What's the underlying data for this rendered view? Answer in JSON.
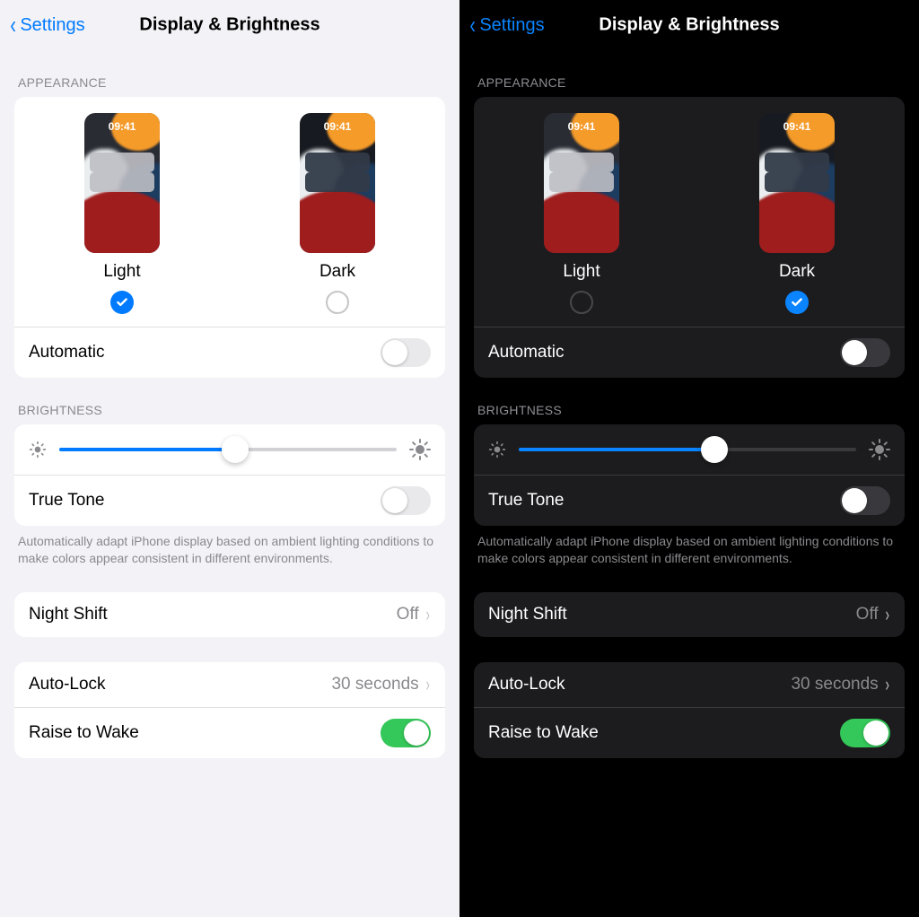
{
  "left": {
    "nav_back": "Settings",
    "nav_title": "Display & Brightness",
    "appearance": {
      "header": "APPEARANCE",
      "light_label": "Light",
      "dark_label": "Dark",
      "preview_time": "09:41",
      "selected": "light",
      "automatic_label": "Automatic",
      "automatic_on": false
    },
    "brightness": {
      "header": "BRIGHTNESS",
      "value_pct": 52,
      "truetone_label": "True Tone",
      "truetone_on": false,
      "truetone_note": "Automatically adapt iPhone display based on ambient lighting conditions to make colors appear consistent in different environments."
    },
    "nightshift": {
      "label": "Night Shift",
      "value": "Off"
    },
    "autolock": {
      "label": "Auto-Lock",
      "value": "30 seconds"
    },
    "raisewake": {
      "label": "Raise to Wake",
      "on": true
    }
  },
  "right": {
    "nav_back": "Settings",
    "nav_title": "Display & Brightness",
    "appearance": {
      "header": "APPEARANCE",
      "light_label": "Light",
      "dark_label": "Dark",
      "preview_time": "09:41",
      "selected": "dark",
      "automatic_label": "Automatic",
      "automatic_on": false
    },
    "brightness": {
      "header": "BRIGHTNESS",
      "value_pct": 58,
      "truetone_label": "True Tone",
      "truetone_on": false,
      "truetone_note": "Automatically adapt iPhone display based on ambient lighting conditions to make colors appear consistent in different environments."
    },
    "nightshift": {
      "label": "Night Shift",
      "value": "Off"
    },
    "autolock": {
      "label": "Auto-Lock",
      "value": "30 seconds"
    },
    "raisewake": {
      "label": "Raise to Wake",
      "on": true
    }
  }
}
